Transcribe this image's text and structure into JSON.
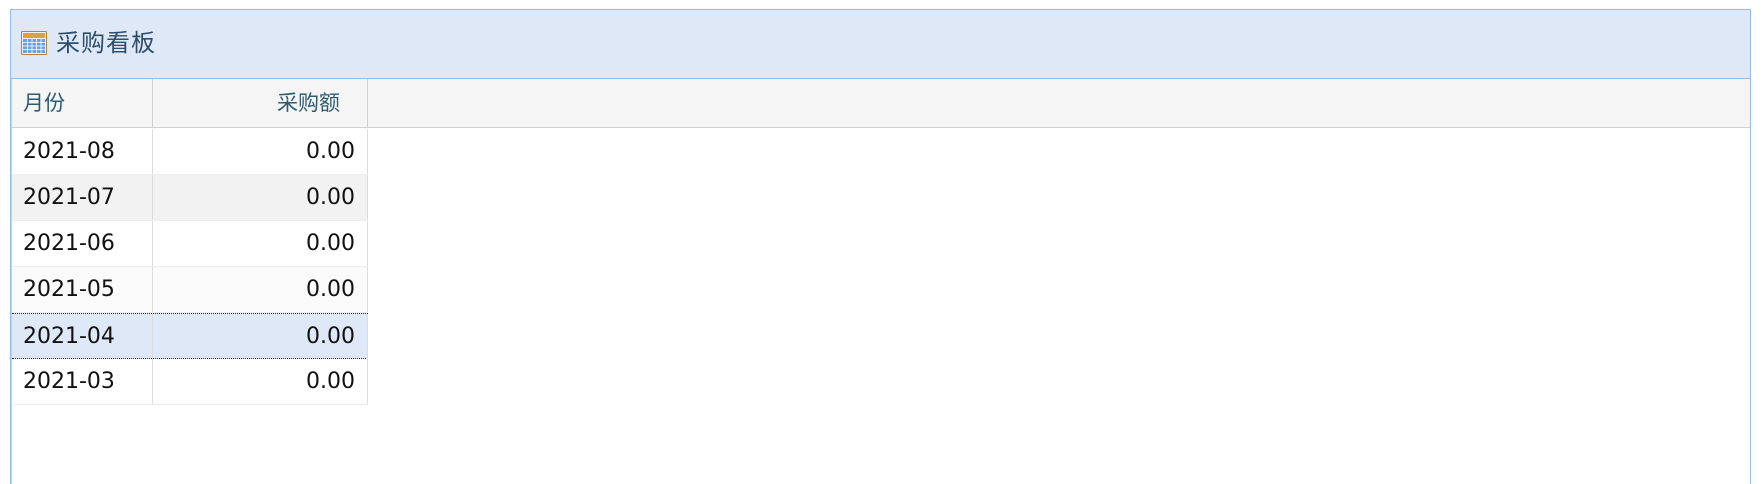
{
  "panel": {
    "title": "采购看板",
    "icon": "grid-table-icon"
  },
  "grid": {
    "columns": [
      {
        "key": "month",
        "label": "月份"
      },
      {
        "key": "amount",
        "label": "采购额"
      }
    ],
    "rows": [
      {
        "month": "2021-08",
        "amount": "0.00"
      },
      {
        "month": "2021-07",
        "amount": "0.00"
      },
      {
        "month": "2021-06",
        "amount": "0.00"
      },
      {
        "month": "2021-05",
        "amount": "0.00"
      },
      {
        "month": "2021-04",
        "amount": "0.00",
        "selected": true
      },
      {
        "month": "2021-03",
        "amount": "0.00"
      }
    ]
  },
  "colors": {
    "header_bg": "#dfe8f6",
    "border": "#99bbe8",
    "title": "#2e4e6e",
    "selected_row": "#dfe8f6"
  }
}
